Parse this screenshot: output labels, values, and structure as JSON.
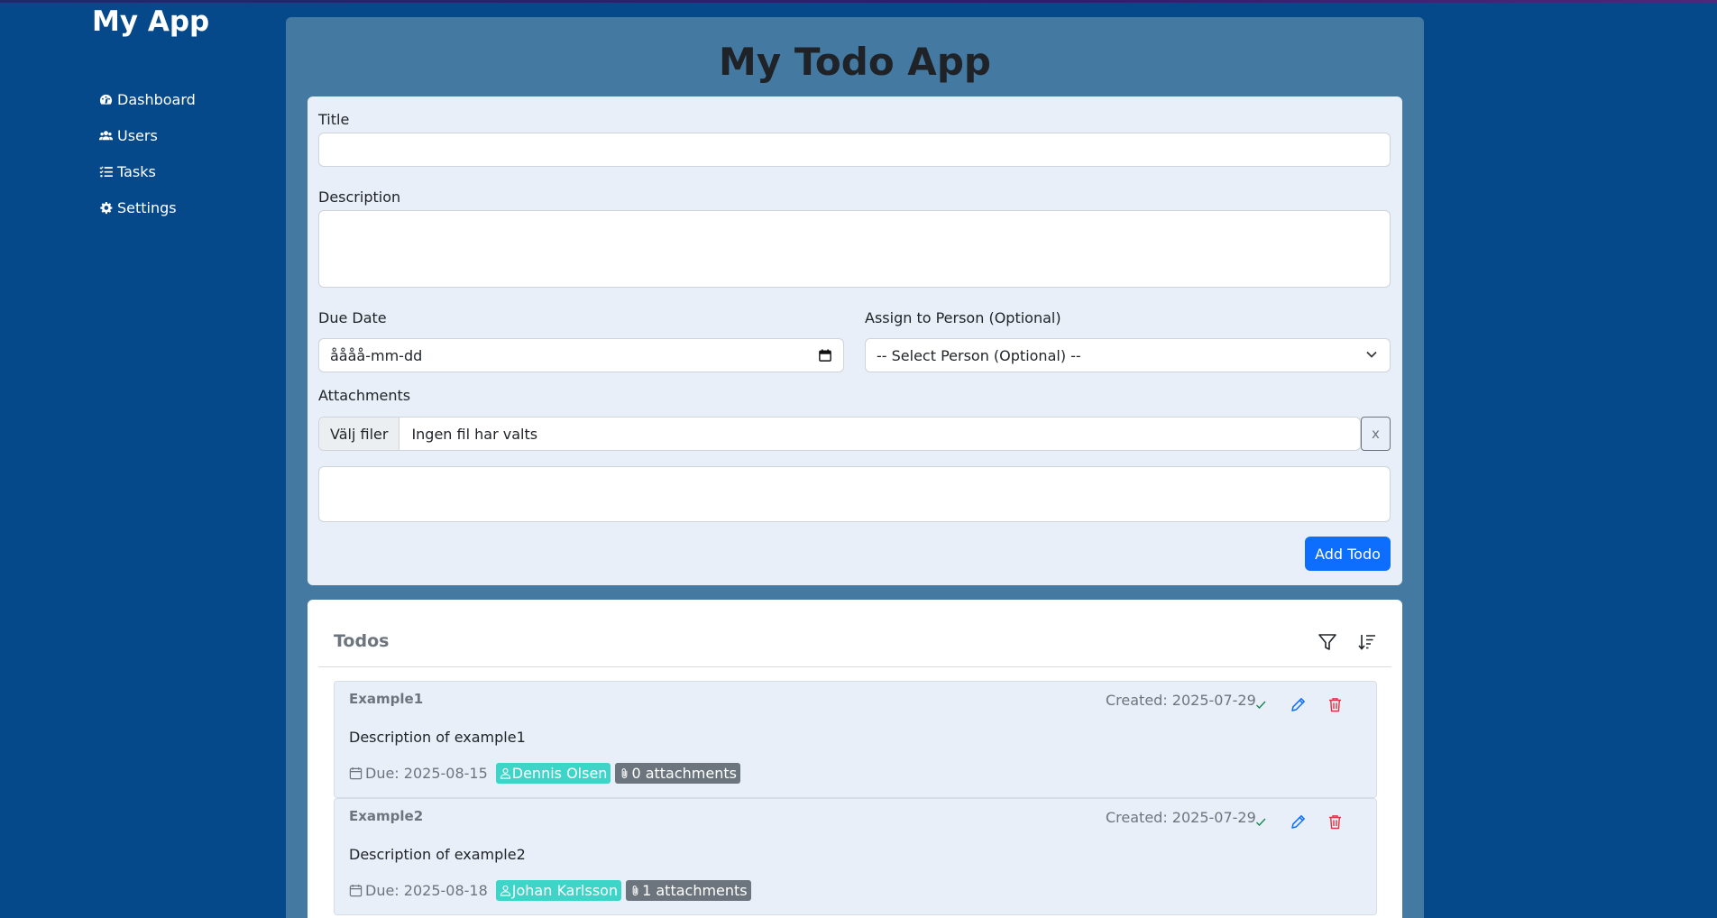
{
  "app": {
    "brand": "My App",
    "title": "My Todo App"
  },
  "sidebar": {
    "items": [
      {
        "label": "Dashboard",
        "icon": "dashboard-icon"
      },
      {
        "label": "Users",
        "icon": "users-icon"
      },
      {
        "label": "Tasks",
        "icon": "tasks-icon"
      },
      {
        "label": "Settings",
        "icon": "gear-icon"
      }
    ]
  },
  "form": {
    "title_label": "Title",
    "title_value": "",
    "description_label": "Description",
    "description_value": "",
    "due_date_label": "Due Date",
    "due_date_placeholder": "åååå-mm-dd",
    "assign_label": "Assign to Person (Optional)",
    "assign_selected": "-- Select Person (Optional) --",
    "attachments_label": "Attachments",
    "file_button": "Välj filer",
    "file_status": "Ingen fil har valts",
    "clear_button": "x",
    "add_button": "Add Todo"
  },
  "todos": {
    "title": "Todos",
    "items": [
      {
        "title": "Example1",
        "created": "Created: 2025-07-29",
        "description": "Description of example1",
        "due": "Due: 2025-08-15",
        "person": "Dennis Olsen",
        "attachments": "0 attachments"
      },
      {
        "title": "Example2",
        "created": "Created: 2025-07-29",
        "description": "Description of example2",
        "due": "Due: 2025-08-18",
        "person": "Johan Karlsson",
        "attachments": "1 attachments"
      }
    ]
  },
  "colors": {
    "background": "#06498a",
    "panel": "#447aa2",
    "card": "#e8eff8",
    "primary": "#0d6efd",
    "person_badge": "#3dd5c8",
    "attach_badge": "#6c757d",
    "complete": "#198754",
    "delete": "#dc3545"
  }
}
